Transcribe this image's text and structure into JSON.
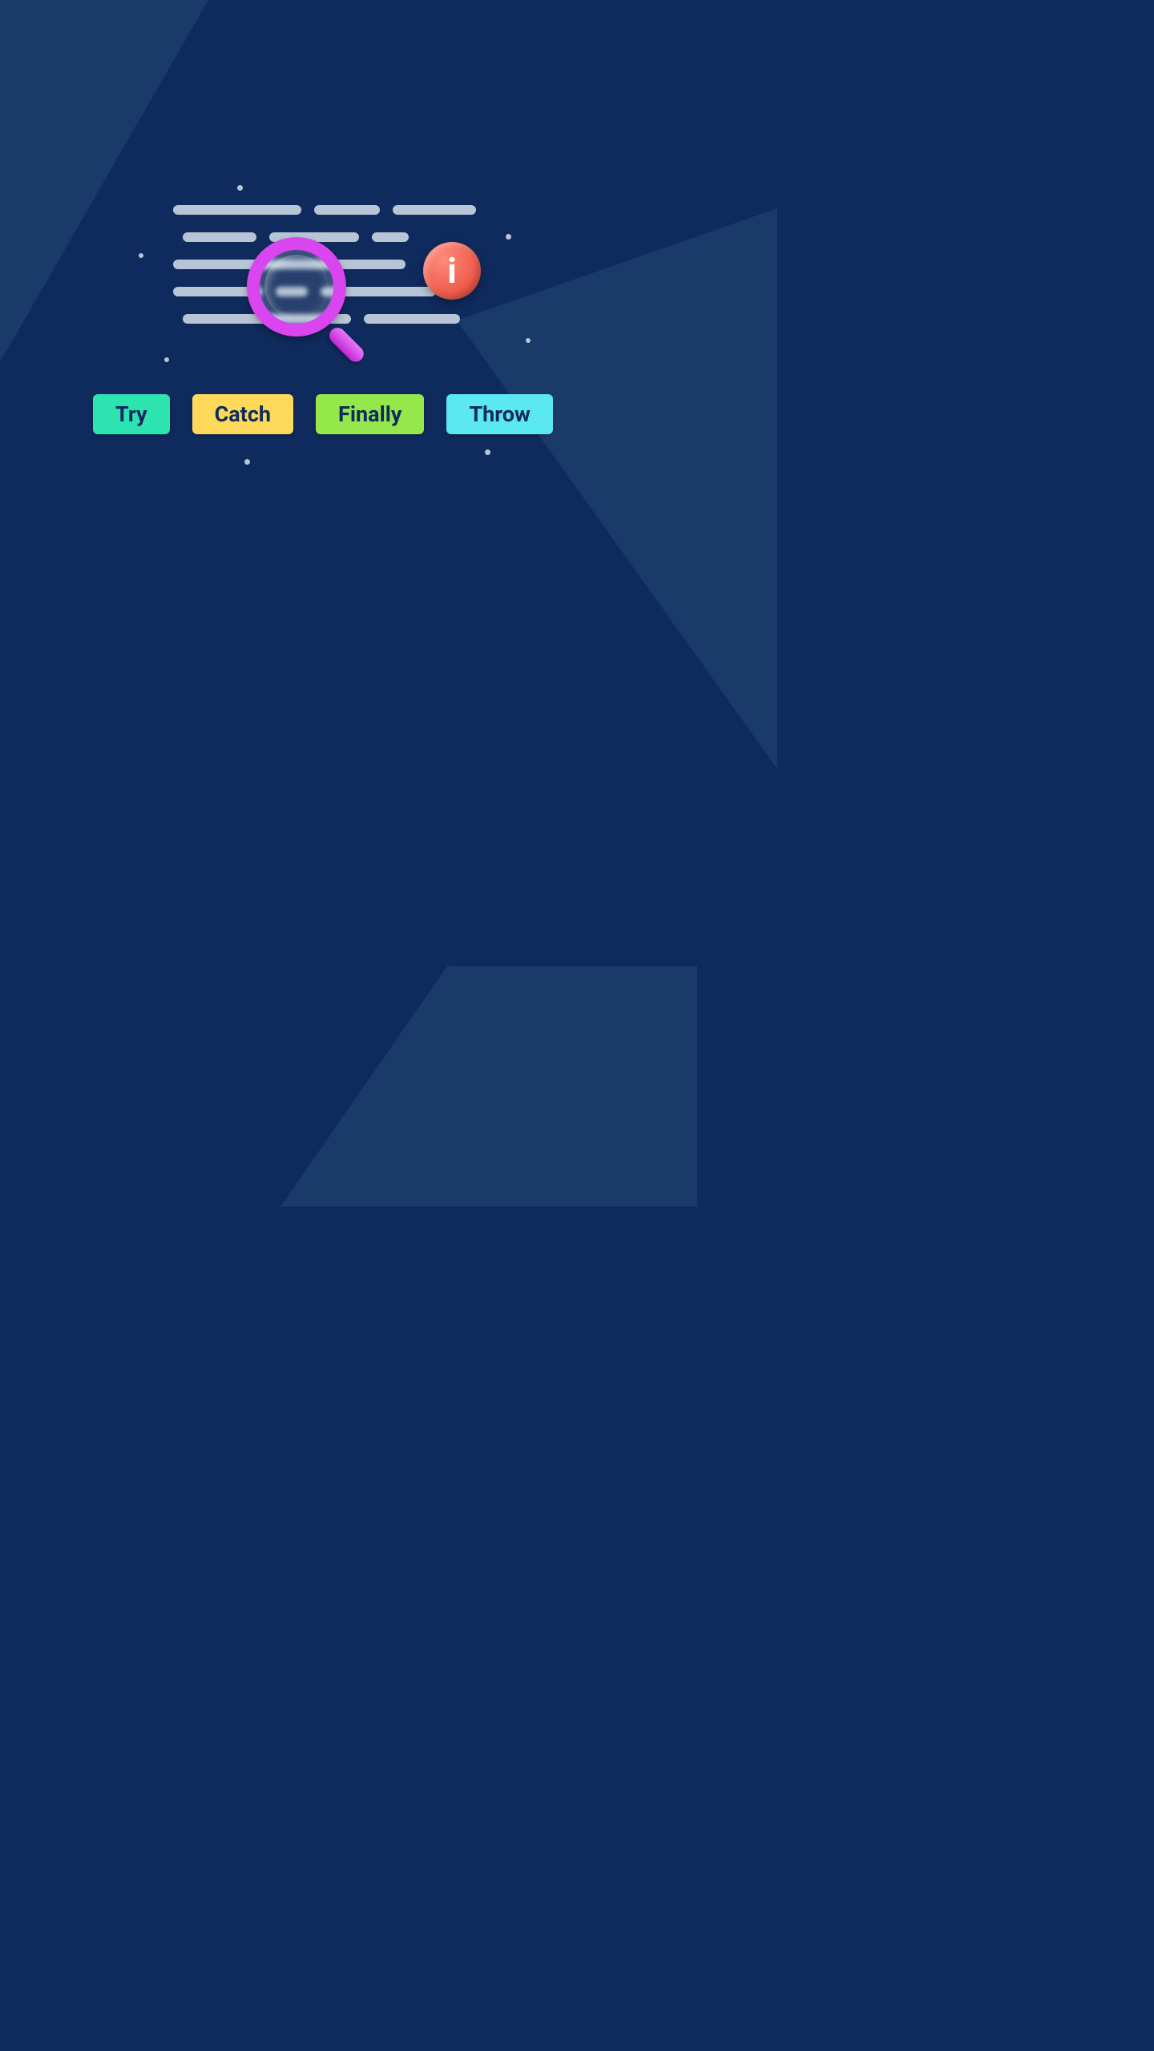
{
  "illustration": {
    "info_badge_glyph": "i",
    "magnifier_icon": "magnifying-glass",
    "info_icon": "info-circle"
  },
  "buttons": {
    "try": "Try",
    "catch": "Catch",
    "finally": "Finally",
    "throw": "Throw"
  },
  "colors": {
    "background": "#0f2a5c",
    "background_accent": "#1a3a6a",
    "code_line": "#b8c5d6",
    "magnifier": "#d946ef",
    "info_badge": "#f05e4e",
    "pill_try": "#2de3b0",
    "pill_catch": "#ffd95a",
    "pill_finally": "#95e84a",
    "pill_throw": "#5ce8f0",
    "text": "#0f2a5c"
  }
}
